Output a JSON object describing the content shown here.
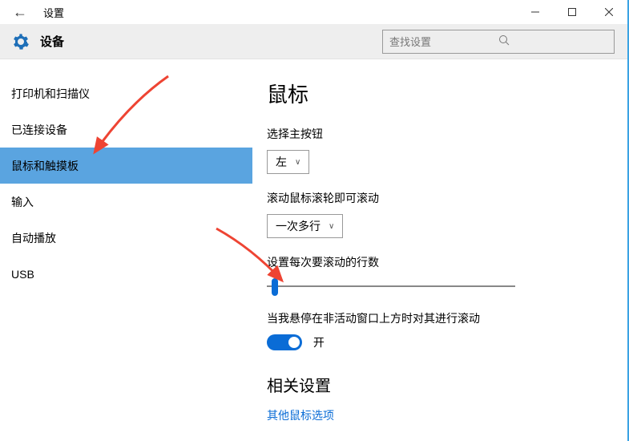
{
  "window": {
    "title": "设置"
  },
  "header": {
    "device": "设备",
    "search_placeholder": "查找设置"
  },
  "nav": {
    "items": [
      {
        "label": "打印机和扫描仪"
      },
      {
        "label": "已连接设备"
      },
      {
        "label": "鼠标和触摸板",
        "selected": true
      },
      {
        "label": "输入"
      },
      {
        "label": "自动播放"
      },
      {
        "label": "USB"
      }
    ]
  },
  "content": {
    "page_title": "鼠标",
    "primary_button_label": "选择主按钮",
    "primary_button_value": "左",
    "scroll_mode_label": "滚动鼠标滚轮即可滚动",
    "scroll_mode_value": "一次多行",
    "lines_label": "设置每次要滚动的行数",
    "inactive_label": "当我悬停在非活动窗口上方时对其进行滚动",
    "toggle_state": "开",
    "related_heading": "相关设置",
    "related_link": "其他鼠标选项"
  }
}
